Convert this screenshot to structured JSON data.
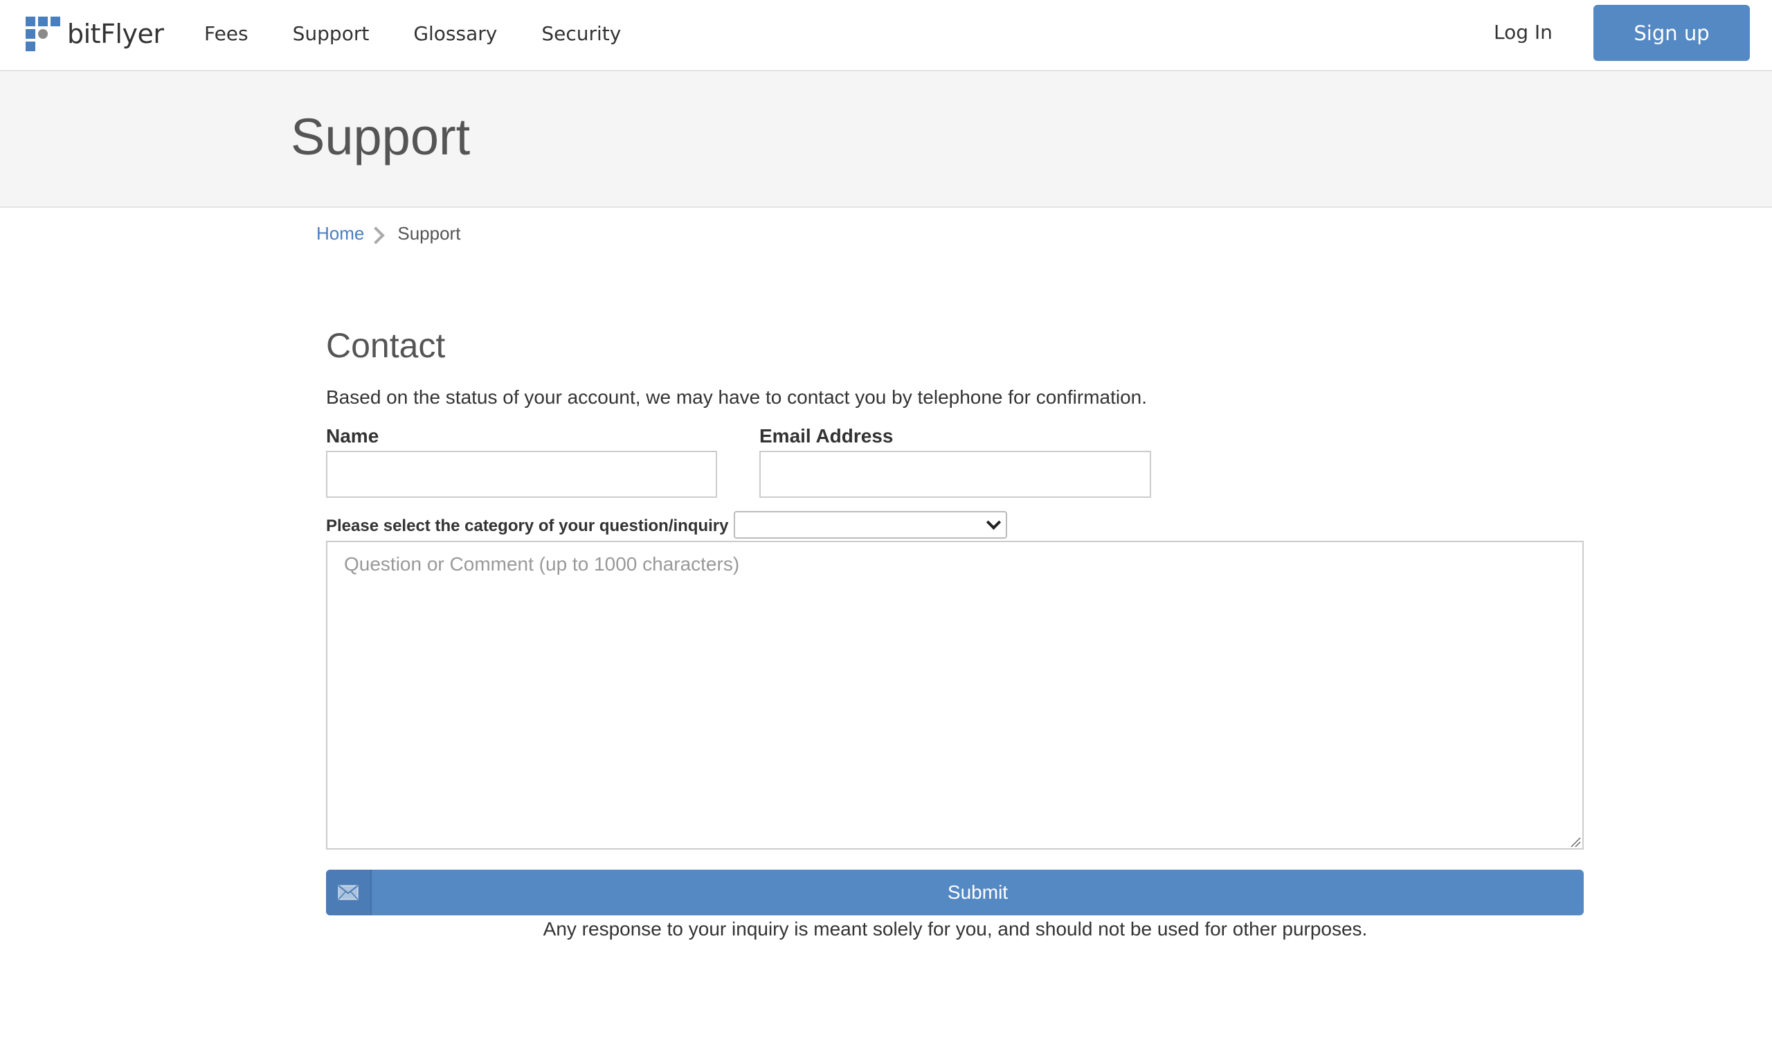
{
  "header": {
    "logo_text": "bitFlyer",
    "nav": [
      "Fees",
      "Support",
      "Glossary",
      "Security"
    ],
    "login_label": "Log In",
    "signup_label": "Sign up"
  },
  "page": {
    "title": "Support"
  },
  "breadcrumb": {
    "home": "Home",
    "current": "Support"
  },
  "contact": {
    "title": "Contact",
    "notice": "Based on the status of your account, we may have to contact you by telephone for confirmation.",
    "name_label": "Name",
    "name_value": "",
    "email_label": "Email Address",
    "email_value": "",
    "category_label": "Please select the category of your question/inquiry",
    "category_selected": "",
    "comment_placeholder": "Question or Comment (up to 1000 characters)",
    "submit_label": "Submit",
    "disclaimer": "Any response to your inquiry is meant solely for you, and should not be used for other purposes."
  },
  "colors": {
    "accent": "#5589c4",
    "link": "#4a7fbf",
    "band_bg": "#f5f5f5"
  },
  "icons": {
    "submit": "envelope-icon",
    "breadcrumb_separator": "chevron-right-icon",
    "select": "chevron-down-icon"
  }
}
